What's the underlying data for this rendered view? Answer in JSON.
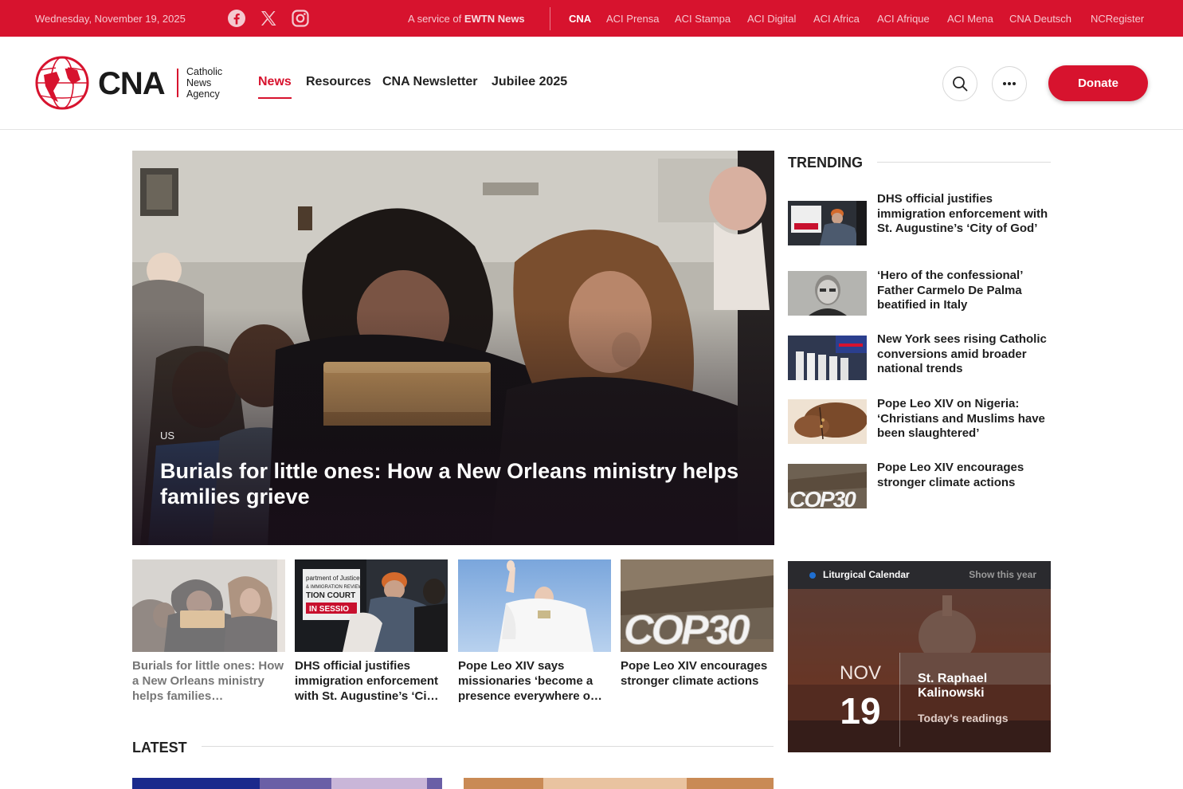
{
  "topbar": {
    "date": "Wednesday, November 19, 2025",
    "social": [
      "facebook-icon",
      "x-icon",
      "instagram-icon"
    ],
    "service_prefix": "A service of ",
    "service_brand": "EWTN News",
    "network": [
      "CNA",
      "ACI Prensa",
      "ACI Stampa",
      "ACI Digital",
      "ACI Africa",
      "ACI Afrique",
      "ACI Mena",
      "CNA Deutsch",
      "NCRegister"
    ]
  },
  "header": {
    "logo_text": "CNA",
    "logo_sub": [
      "Catholic",
      "News",
      "Agency"
    ],
    "nav": [
      "News",
      "Resources",
      "CNA Newsletter",
      "Jubilee 2025"
    ],
    "search_icon": "search-icon",
    "more_icon": "more-horizontal-icon",
    "donate": "Donate"
  },
  "hero": {
    "category": "US",
    "title": "Burials for little ones: How a New Orleans ministry helps families grieve"
  },
  "cards": [
    {
      "title": "Burials for little ones: How a New Orleans ministry helps families…"
    },
    {
      "title": "DHS official justifies immigration enforcement with St. Augustine’s ‘Ci…"
    },
    {
      "title": "Pope Leo XIV says missionaries ‘become a presence everywhere o…"
    },
    {
      "title": "Pope Leo XIV encourages stronger climate actions"
    }
  ],
  "latest": {
    "heading": "LATEST"
  },
  "trending": {
    "heading": "TRENDING",
    "items": [
      {
        "title": "DHS official justifies immigration enforcement with St. Augustine’s ‘City of God’"
      },
      {
        "title": "‘Hero of the confessional’ Father Carmelo De Palma beatified in Italy"
      },
      {
        "title": "New York sees rising Catholic conversions amid broader national trends"
      },
      {
        "title": "Pope Leo XIV on Nigeria: ‘Christians and Muslims have been slaughtered’"
      },
      {
        "title": "Pope Leo XIV encourages stronger climate actions"
      }
    ]
  },
  "liturgical": {
    "title": "Liturgical Calendar",
    "show_label": "Show this year",
    "month": "NOV",
    "day": "19",
    "saint": "St. Raphael Kalinowski",
    "readings": "Today's readings"
  },
  "images": {
    "cop30_text": "COP30",
    "court_sign_1": "partment of Justice",
    "court_sign_2": "& IMMIGRATION REVIEW",
    "court_sign_3": "TION COURT",
    "court_sign_4": "IN SESSIO"
  },
  "colors": {
    "brand_red": "#d7132e",
    "calendar_dot": "#1f6fd1"
  }
}
